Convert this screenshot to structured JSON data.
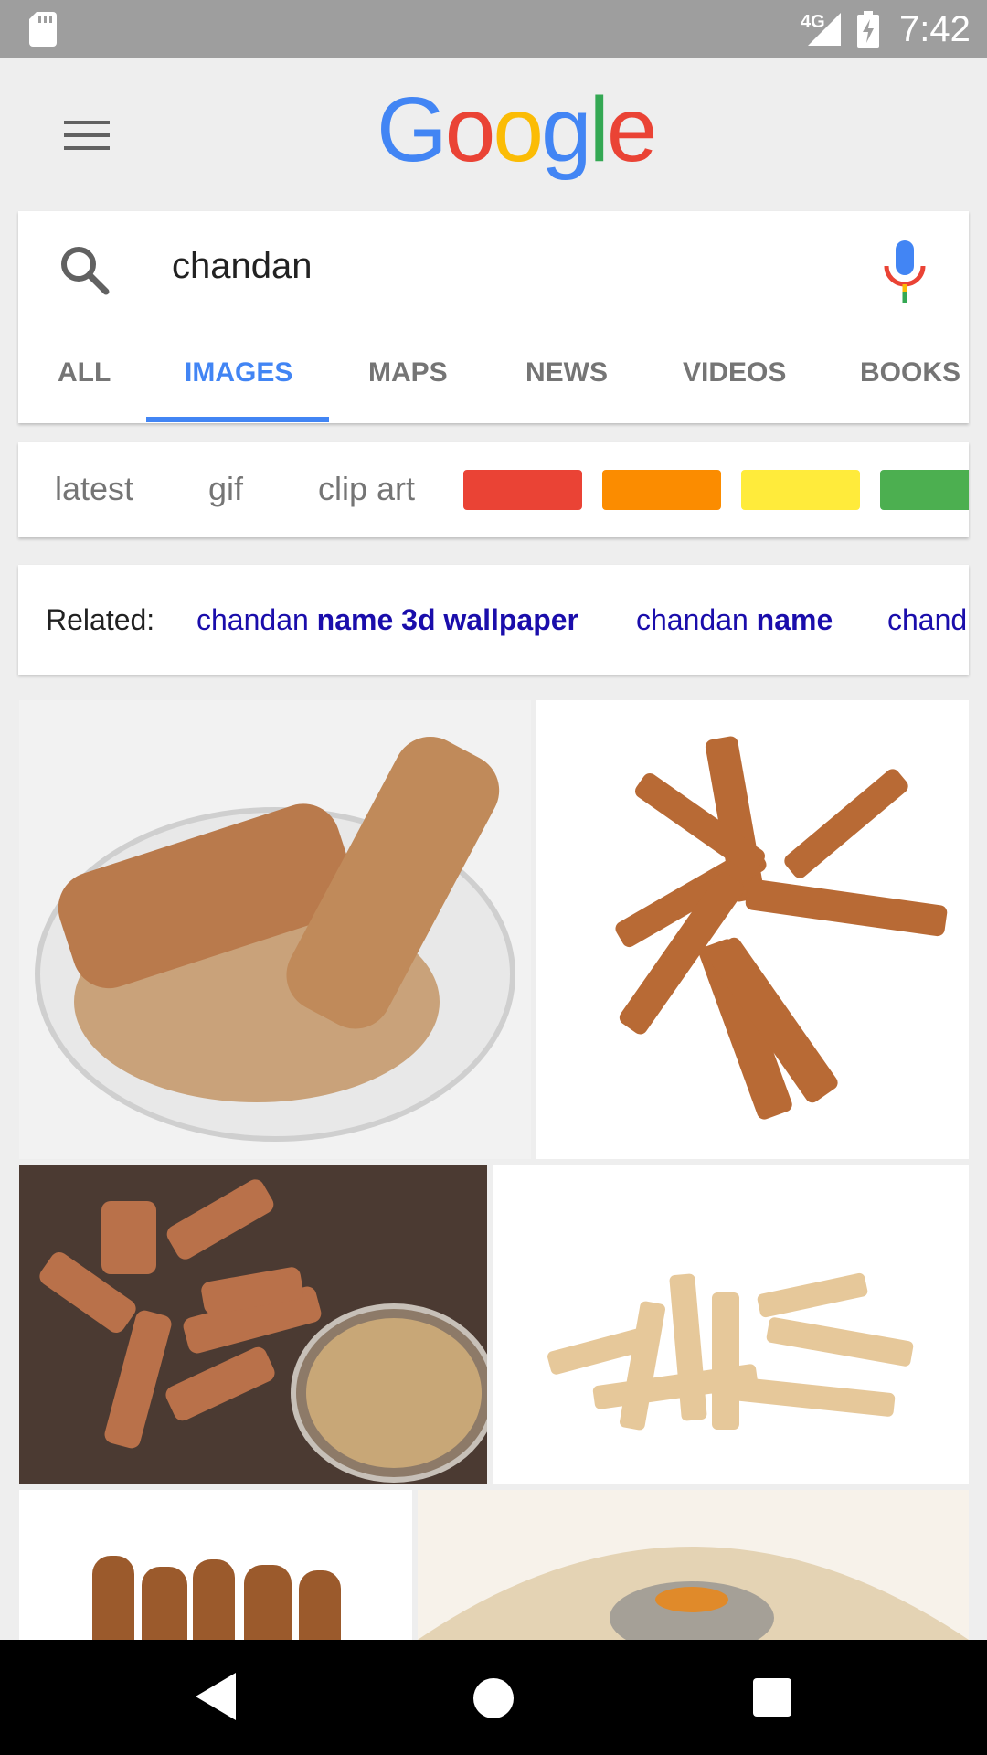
{
  "status_bar": {
    "network": "4G",
    "time": "7:42"
  },
  "header": {
    "logo_letters": [
      "G",
      "o",
      "o",
      "g",
      "l",
      "e"
    ]
  },
  "search": {
    "query": "chandan"
  },
  "tabs": [
    {
      "label": "ALL",
      "active": false
    },
    {
      "label": "IMAGES",
      "active": true
    },
    {
      "label": "MAPS",
      "active": false
    },
    {
      "label": "NEWS",
      "active": false
    },
    {
      "label": "VIDEOS",
      "active": false
    },
    {
      "label": "BOOKS",
      "active": false
    }
  ],
  "filters": {
    "text_chips": [
      "latest",
      "gif",
      "clip art"
    ],
    "color_chips": [
      "#ea4335",
      "#fb8c00",
      "#ffeb3b",
      "#4caf50"
    ]
  },
  "related": {
    "label": "Related:",
    "links": [
      {
        "plain": "chandan ",
        "bold": "name 3d wallpaper"
      },
      {
        "plain": "chandan ",
        "bold": "name"
      },
      {
        "plain": "chand",
        "bold": ""
      }
    ]
  },
  "colors": {
    "accent": "#4285f4",
    "link": "#1a0dab"
  }
}
